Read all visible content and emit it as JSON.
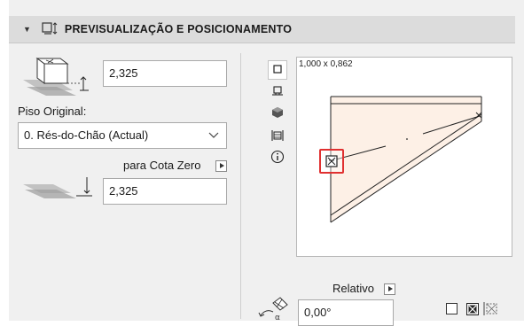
{
  "section": {
    "title": "PREVISUALIZAÇÃO E POSICIONAMENTO"
  },
  "elevation": {
    "value": "2,325"
  },
  "home_story": {
    "label": "Piso Original:",
    "selected": "0. Rés-do-Chão (Actual)"
  },
  "reference": {
    "label": "para Cota Zero",
    "value": "2,325"
  },
  "preview": {
    "size_readout": "1,000 x 0,862",
    "view_buttons": [
      "plan-view-icon",
      "elevation-view-icon",
      "3d-view-icon",
      "section-view-icon",
      "info-icon"
    ]
  },
  "rotation": {
    "label": "Relativo",
    "value": "0,00°"
  },
  "colors": {
    "header_bg": "#dcdcdc",
    "fill": "#fdf0e6",
    "highlight": "#e03030"
  }
}
